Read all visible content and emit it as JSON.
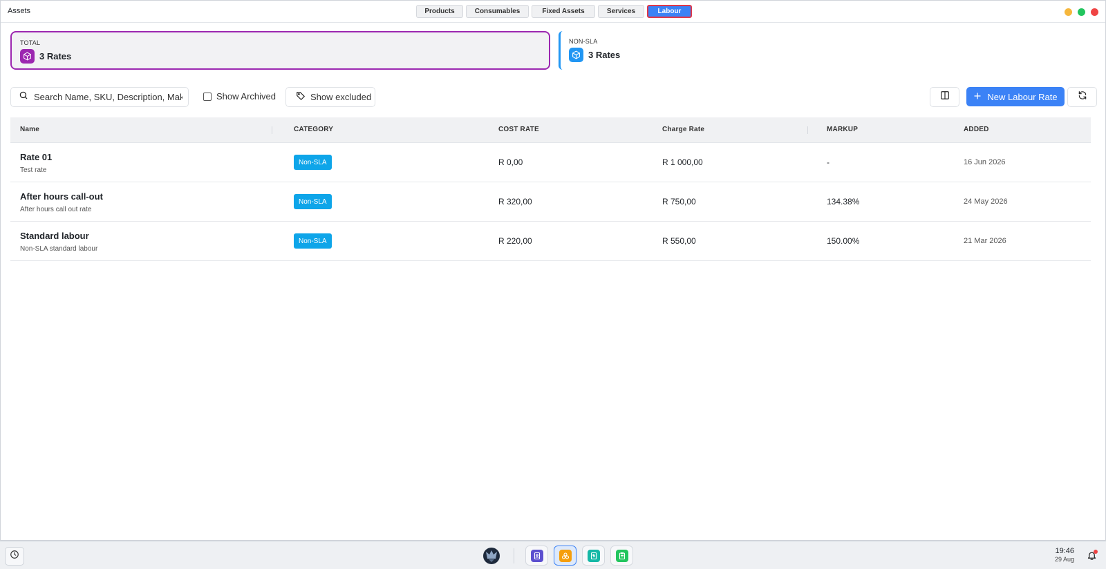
{
  "window": {
    "title": "Assets"
  },
  "tabs": [
    {
      "label": "Products",
      "active": false
    },
    {
      "label": "Consumables",
      "active": false
    },
    {
      "label": "Fixed Assets",
      "active": false
    },
    {
      "label": "Services",
      "active": false
    },
    {
      "label": "Labour",
      "active": true
    }
  ],
  "window_controls": {
    "minimize": "#f6b73c",
    "maximize": "#22c55e",
    "close": "#ef4444"
  },
  "summary": {
    "total": {
      "label": "TOTAL",
      "value": "3 Rates",
      "accent": "#9c27b0"
    },
    "non_sla": {
      "label": "NON-SLA",
      "value": "3 Rates",
      "accent": "#2196f3"
    }
  },
  "toolbar": {
    "search_placeholder": "Search Name, SKU, Description, Make,",
    "show_archived_label": "Show Archived",
    "show_archived_checked": false,
    "show_excluded_label": "Show excluded",
    "new_button_label": "New Labour Rate",
    "accent": "#3b82f6"
  },
  "table": {
    "headers": {
      "name": "Name",
      "category": "CATEGORY",
      "cost_rate": "COST RATE",
      "charge_rate": "Charge Rate",
      "markup": "MARKUP",
      "added": "ADDED"
    },
    "rows": [
      {
        "name": "Rate 01",
        "description": "Test rate",
        "category": "Non-SLA",
        "cost_rate": "R 0,00",
        "charge_rate": "R 1 000,00",
        "markup": "-",
        "added": "16 Jun 2026"
      },
      {
        "name": "After hours call-out",
        "description": "After hours call out rate",
        "category": "Non-SLA",
        "cost_rate": "R 320,00",
        "charge_rate": "R 750,00",
        "markup": "134.38%",
        "added": "24 May 2026"
      },
      {
        "name": "Standard labour",
        "description": "Non-SLA standard labour",
        "category": "Non-SLA",
        "cost_rate": "R 220,00",
        "charge_rate": "R 550,00",
        "markup": "150.00%",
        "added": "21 Mar 2026"
      }
    ]
  },
  "taskbar": {
    "time": "19:46",
    "date": "29 Aug",
    "apps": [
      {
        "icon": "contacts-icon",
        "color": "#5b4fcf",
        "active": false
      },
      {
        "icon": "assets-icon",
        "color": "#f59e0b",
        "active": true
      },
      {
        "icon": "invoice-icon",
        "color": "#14b8a6",
        "active": false
      },
      {
        "icon": "clipboard-icon",
        "color": "#22c55e",
        "active": false
      }
    ]
  }
}
